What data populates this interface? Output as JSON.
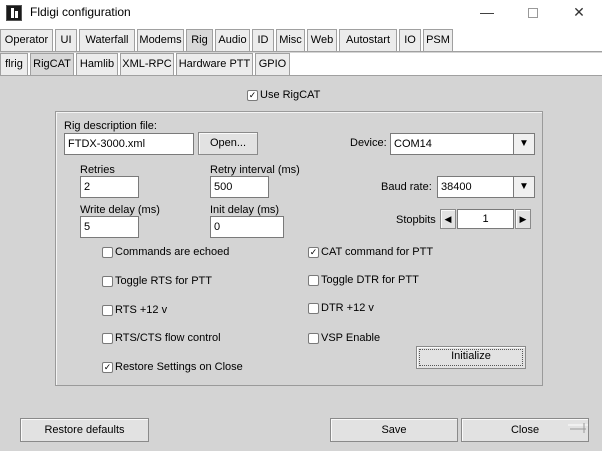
{
  "window": {
    "title": "Fldigi configuration",
    "minimize_glyph": "—",
    "close_glyph": "✕"
  },
  "tabs_main": [
    "Operator",
    "UI",
    "Waterfall",
    "Modems",
    "Rig",
    "Audio",
    "ID",
    "Misc",
    "Web",
    "Autostart",
    "IO",
    "PSM"
  ],
  "tabs_main_active": "Rig",
  "tabs_sub": [
    "flrig",
    "RigCAT",
    "Hamlib",
    "XML-RPC",
    "Hardware PTT",
    "GPIO"
  ],
  "tabs_sub_active": "RigCAT",
  "rigcat": {
    "use_rigcat_label": "Use RigCAT",
    "use_rigcat_checked": true,
    "rig_desc_label": "Rig description file:",
    "rig_desc_value": "FTDX-3000.xml",
    "open_button": "Open...",
    "device_label": "Device:",
    "device_value": "COM14",
    "retries_label": "Retries",
    "retries_value": "2",
    "retry_interval_label": "Retry interval (ms)",
    "retry_interval_value": "500",
    "baud_label": "Baud rate:",
    "baud_value": "38400",
    "write_delay_label": "Write delay (ms)",
    "write_delay_value": "5",
    "init_delay_label": "Init delay (ms)",
    "init_delay_value": "0",
    "stopbits_label": "Stopbits",
    "stopbits_value": "1",
    "checkboxes_left": [
      {
        "label": "Commands are echoed",
        "checked": false
      },
      {
        "label": "Toggle RTS for PTT",
        "checked": false
      },
      {
        "label": "RTS +12 v",
        "checked": false
      },
      {
        "label": "RTS/CTS flow control",
        "checked": false
      },
      {
        "label": "Restore Settings on Close",
        "checked": true
      }
    ],
    "checkboxes_right": [
      {
        "label": "CAT command for PTT",
        "checked": true
      },
      {
        "label": "Toggle DTR for PTT",
        "checked": false
      },
      {
        "label": "DTR +12 v",
        "checked": false
      },
      {
        "label": "VSP Enable",
        "checked": false
      }
    ],
    "initialize_button": "Initialize"
  },
  "footer": {
    "restore_defaults": "Restore defaults",
    "save": "Save",
    "close": "Close"
  },
  "icons": {
    "checkmark": "✓",
    "dropdown_arrow": "▼",
    "left_arrow": "◀",
    "right_arrow": "▶"
  }
}
